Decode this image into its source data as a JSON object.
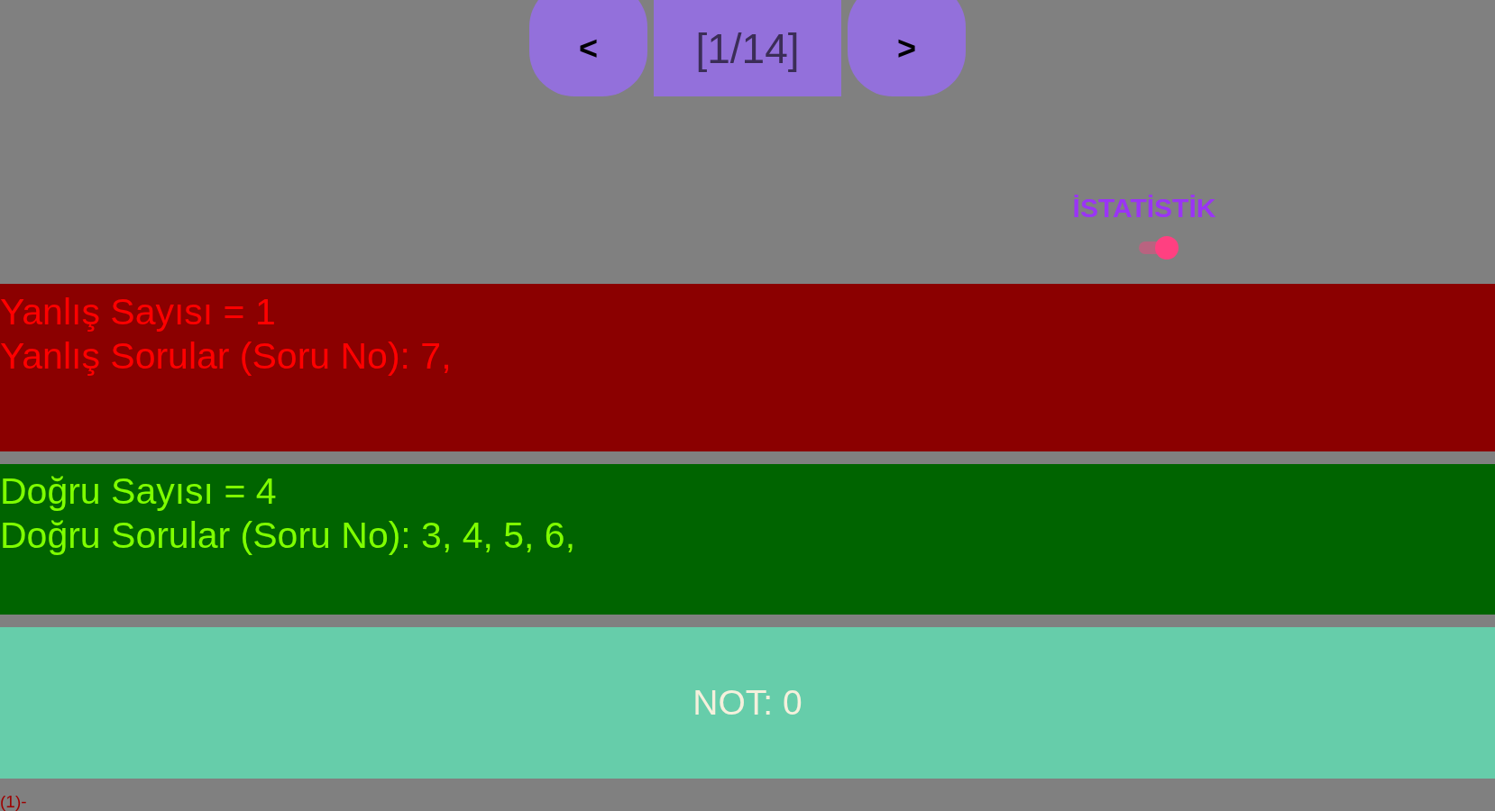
{
  "pager": {
    "previous": "<",
    "page": "[1/14]",
    "next": ">"
  },
  "statistics": {
    "label": "İSTATİSTİK",
    "on": true
  },
  "results": [
    {
      "kind": "wrong",
      "lines": [
        "Yanlış Sayısı = 1",
        "Yanlış Sorular (Soru No): 7,"
      ]
    },
    {
      "kind": "correct",
      "lines": [
        "Doğru Sayısı = 4",
        "Doğru Sorular (Soru No): 3, 4, 5, 6,"
      ]
    }
  ],
  "grade": "NOT: 0",
  "footer_text": "(1)-"
}
